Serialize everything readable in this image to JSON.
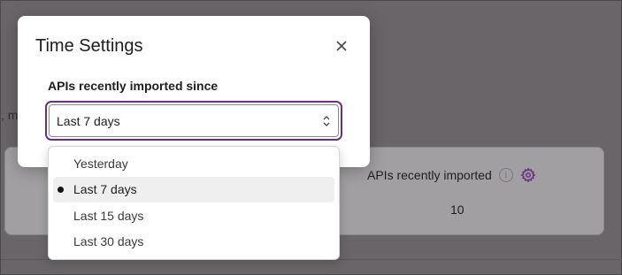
{
  "background": {
    "fragment_text": ", m",
    "card": {
      "title": "APIs recently imported",
      "value": "10",
      "info_icon": "info-icon",
      "settings_icon": "gear-icon",
      "accent_color": "#6b2d86"
    }
  },
  "modal": {
    "title": "Time Settings",
    "close_icon": "close-icon",
    "field_label": "APIs recently imported since",
    "selected_value": "Last 7 days",
    "select_icon": "chevron-updown-icon",
    "focus_color": "#6b2d86"
  },
  "dropdown": {
    "options": [
      {
        "label": "Yesterday",
        "selected": false
      },
      {
        "label": "Last 7 days",
        "selected": true
      },
      {
        "label": "Last 15 days",
        "selected": false
      },
      {
        "label": "Last 30 days",
        "selected": false
      }
    ]
  }
}
